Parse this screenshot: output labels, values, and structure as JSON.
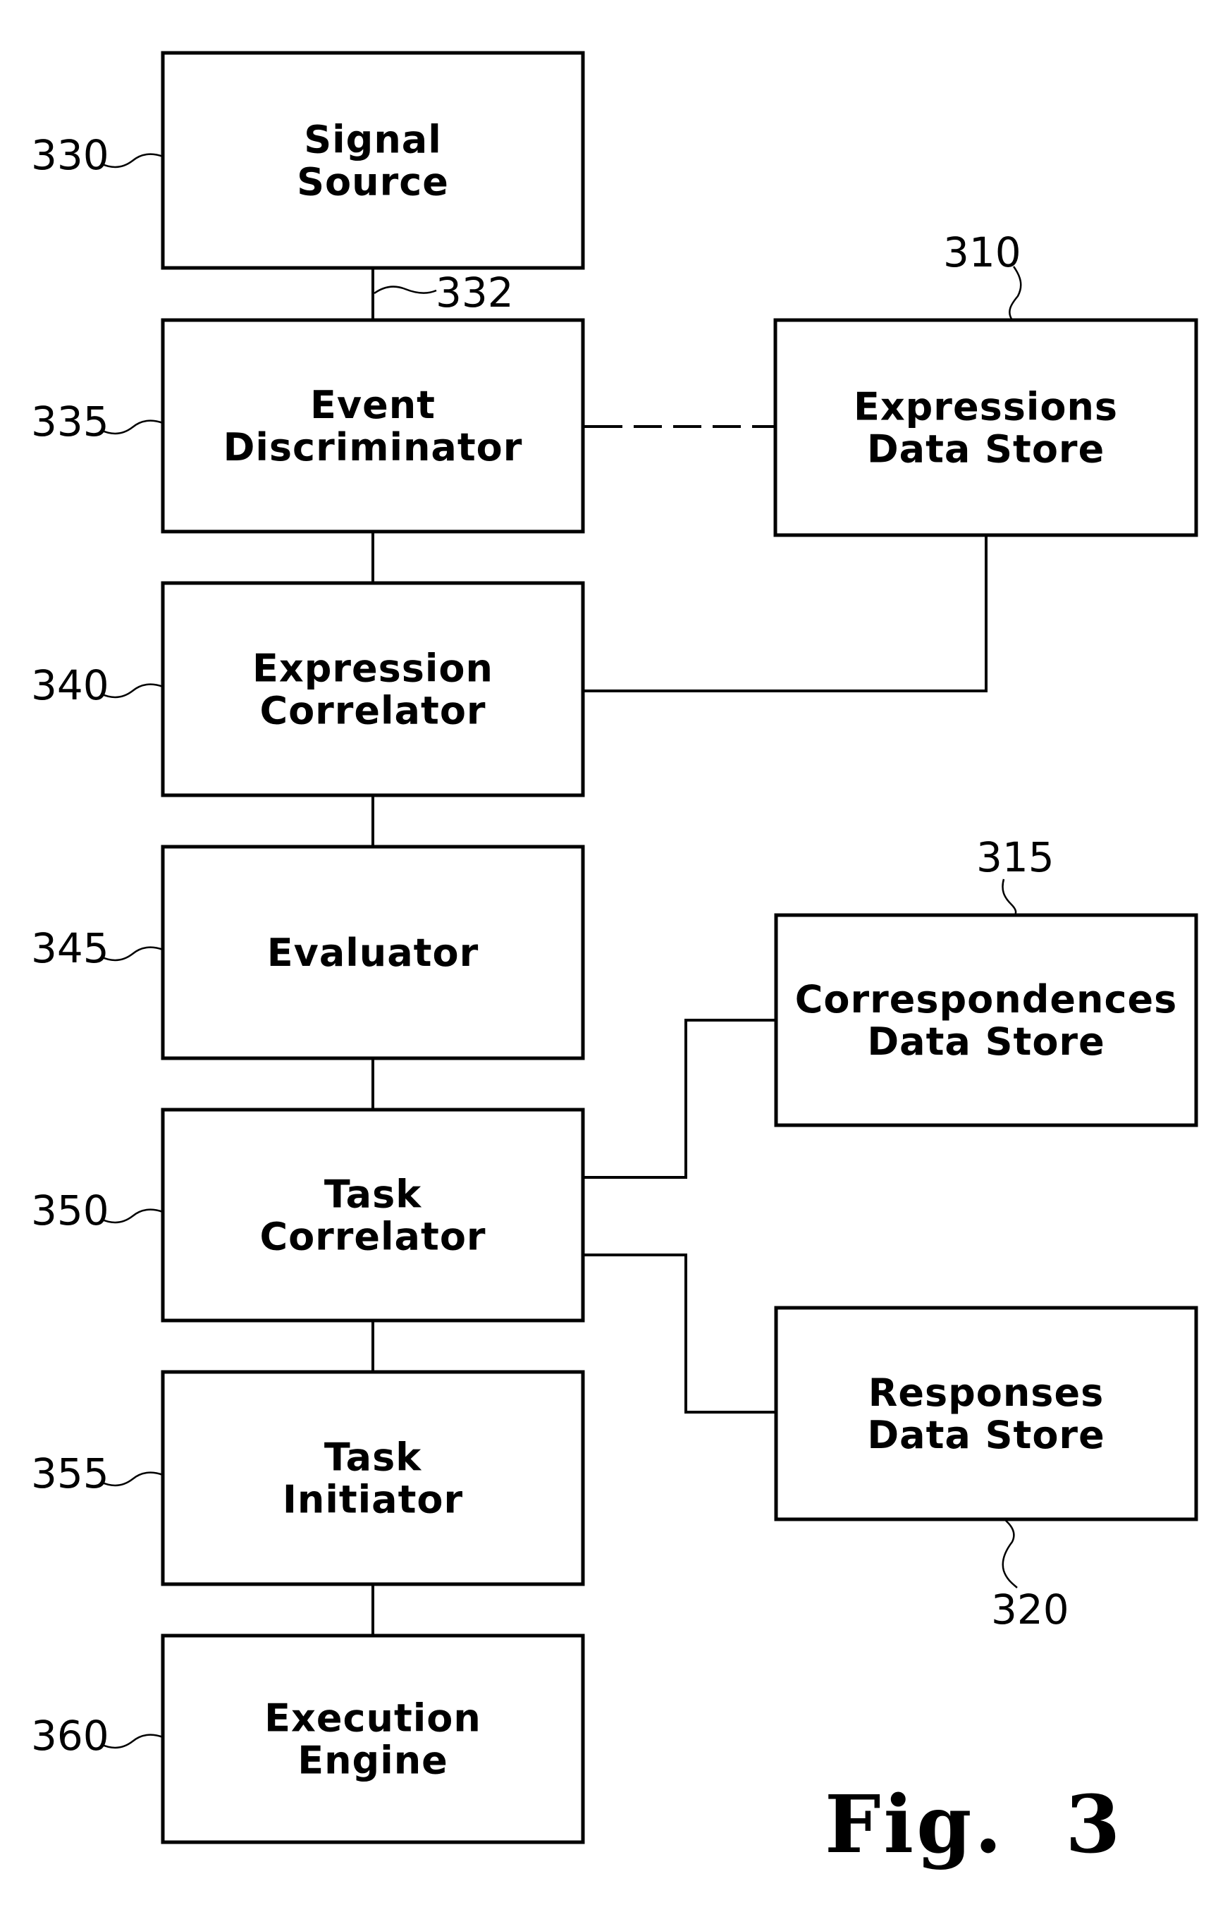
{
  "figure": {
    "caption": "Fig.  3",
    "blocks": [
      {
        "id": "signal-source",
        "ref": "330",
        "lines": [
          "Signal",
          "Source"
        ]
      },
      {
        "id": "event-discriminator",
        "ref": "335",
        "lines": [
          "Event",
          "Discriminator"
        ]
      },
      {
        "id": "expression-correlator",
        "ref": "340",
        "lines": [
          "Expression",
          "Correlator"
        ]
      },
      {
        "id": "evaluator",
        "ref": "345",
        "lines": [
          "Evaluator"
        ]
      },
      {
        "id": "task-correlator",
        "ref": "350",
        "lines": [
          "Task",
          "Correlator"
        ]
      },
      {
        "id": "task-initiator",
        "ref": "355",
        "lines": [
          "Task",
          "Initiator"
        ]
      },
      {
        "id": "execution-engine",
        "ref": "360",
        "lines": [
          "Execution",
          "Engine"
        ]
      }
    ],
    "stores": [
      {
        "id": "expressions-data-store",
        "ref": "310",
        "lines": [
          "Expressions",
          "Data  Store"
        ]
      },
      {
        "id": "correspondences-data-store",
        "ref": "315",
        "lines": [
          "Correspondences",
          "Data  Store"
        ]
      },
      {
        "id": "responses-data-store",
        "ref": "320",
        "lines": [
          "Responses",
          "Data  Store"
        ]
      }
    ],
    "signal_line_ref": "332",
    "connections": [
      {
        "from": "signal-source",
        "to": "event-discriminator",
        "style": "solid"
      },
      {
        "from": "event-discriminator",
        "to": "expression-correlator",
        "style": "solid"
      },
      {
        "from": "expression-correlator",
        "to": "evaluator",
        "style": "solid"
      },
      {
        "from": "evaluator",
        "to": "task-correlator",
        "style": "solid"
      },
      {
        "from": "task-correlator",
        "to": "task-initiator",
        "style": "solid"
      },
      {
        "from": "task-initiator",
        "to": "execution-engine",
        "style": "solid"
      },
      {
        "from": "event-discriminator",
        "to": "expressions-data-store",
        "style": "dashed"
      },
      {
        "from": "expression-correlator",
        "to": "expressions-data-store",
        "style": "solid"
      },
      {
        "from": "task-correlator",
        "to": "correspondences-data-store",
        "style": "solid"
      },
      {
        "from": "task-correlator",
        "to": "responses-data-store",
        "style": "solid"
      }
    ]
  }
}
